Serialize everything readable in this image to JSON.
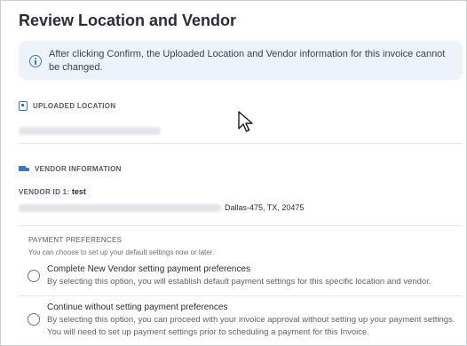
{
  "page": {
    "title": "Review Location and Vendor"
  },
  "alert": {
    "icon": "info-icon",
    "message": "After clicking Confirm, the Uploaded Location and Vendor information for this invoice cannot be changed."
  },
  "uploaded_location": {
    "icon": "building-icon",
    "heading": "UPLOADED LOCATION"
  },
  "vendor_information": {
    "icon": "truck-icon",
    "heading": "VENDOR INFORMATION",
    "vendor_id_label": "VENDOR ID 1:",
    "vendor_id_value": "test",
    "address_visible": "Dallas-475, TX, 20475"
  },
  "payment_preferences": {
    "heading": "PAYMENT PREFERENCES",
    "subtext": "You can choose to set up your default settings now or later.",
    "options": [
      {
        "title": "Complete New Vendor setting payment preferences",
        "description": "By selecting this option, you will establish default payment settings for this specific location and vendor."
      },
      {
        "title": "Continue without setting payment preferences",
        "description": "By selecting this option, you can proceed with your invoice approval without setting up your payment settings. You will need to set up payment settings prior to scheduling a payment for this Invoice."
      }
    ]
  },
  "colors": {
    "accent": "#3f74c9",
    "alert_bg": "#eef3fb",
    "text": "#2a2d38"
  }
}
